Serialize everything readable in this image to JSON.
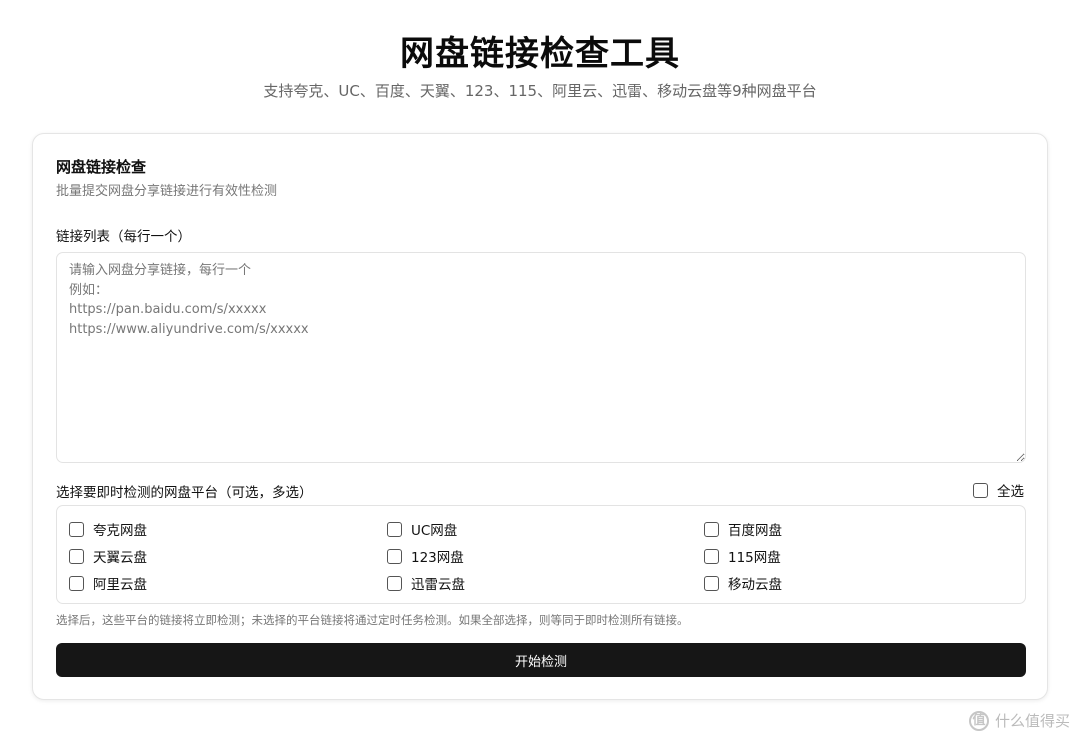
{
  "header": {
    "title": "网盘链接检查工具",
    "subtitle": "支持夸克、UC、百度、天翼、123、115、阿里云、迅雷、移动云盘等9种网盘平台"
  },
  "card": {
    "title": "网盘链接检查",
    "description": "批量提交网盘分享链接进行有效性检测",
    "links_label": "链接列表（每行一个）",
    "links_value": "",
    "links_placeholder": "请输入网盘分享链接，每行一个\n例如：\nhttps://pan.baidu.com/s/xxxxx\nhttps://www.aliyundrive.com/s/xxxxx",
    "platform_label": "选择要即时检测的网盘平台（可选，多选）",
    "select_all_label": "全选",
    "platforms": [
      {
        "label": "夸克网盘",
        "checked": false
      },
      {
        "label": "UC网盘",
        "checked": false
      },
      {
        "label": "百度网盘",
        "checked": false
      },
      {
        "label": "天翼云盘",
        "checked": false
      },
      {
        "label": "123网盘",
        "checked": false
      },
      {
        "label": "115网盘",
        "checked": false
      },
      {
        "label": "阿里云盘",
        "checked": false
      },
      {
        "label": "迅雷云盘",
        "checked": false
      },
      {
        "label": "移动云盘",
        "checked": false
      }
    ],
    "hint": "选择后，这些平台的链接将立即检测；未选择的平台链接将通过定时任务检测。如果全部选择，则等同于即时检测所有链接。",
    "start_button_label": "开始检测"
  },
  "watermark": {
    "icon": "zhi-logo-icon",
    "text": "什么值得买"
  },
  "colors": {
    "button_bg": "#161616",
    "button_text": "#ffffff",
    "muted_text": "#777777",
    "border": "#e3e3e3"
  }
}
